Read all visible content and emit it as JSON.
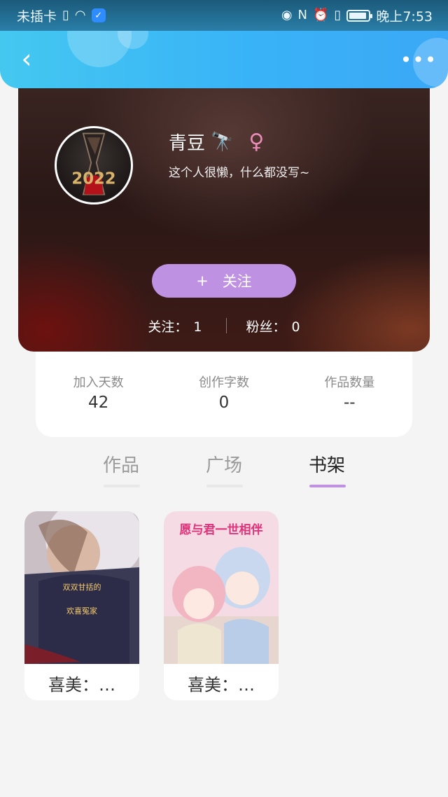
{
  "status_bar": {
    "carrier": "未插卡",
    "time": "晚上7:53",
    "icons": [
      "sim-alert-icon",
      "wifi-icon",
      "shield-icon",
      "eye-icon",
      "nfc-icon",
      "alarm-icon",
      "vibrate-icon",
      "battery-icon"
    ]
  },
  "header": {
    "back_icon": "‹",
    "more_icon": "•••"
  },
  "profile": {
    "nickname": "青豆",
    "nickname_emoji": "🔭",
    "gender_symbol": "♀",
    "bio": "这个人很懒，什么都没写~",
    "avatar_text": "2022",
    "follow_plus": "+",
    "follow_label": "关注",
    "following_label": "关注：",
    "following_count": "1",
    "fans_label": "粉丝：",
    "fans_count": "0"
  },
  "summary": {
    "items": [
      {
        "label": "加入天数",
        "value": "42"
      },
      {
        "label": "创作字数",
        "value": "0"
      },
      {
        "label": "作品数量",
        "value": "--"
      }
    ]
  },
  "tabs": [
    {
      "label": "作品",
      "active": false
    },
    {
      "label": "广场",
      "active": false
    },
    {
      "label": "书架",
      "active": true
    }
  ],
  "books": [
    {
      "title": "喜美：…",
      "cover_text_1": "双双甘括的",
      "cover_text_2": "欢喜冤家"
    },
    {
      "title": "喜美：…",
      "cover_text_1": "愿与君一世相伴"
    }
  ],
  "colors": {
    "header_blue": "#39b3f7",
    "accent_purple": "#bf91e3",
    "gender_pink": "#e98cb8"
  }
}
